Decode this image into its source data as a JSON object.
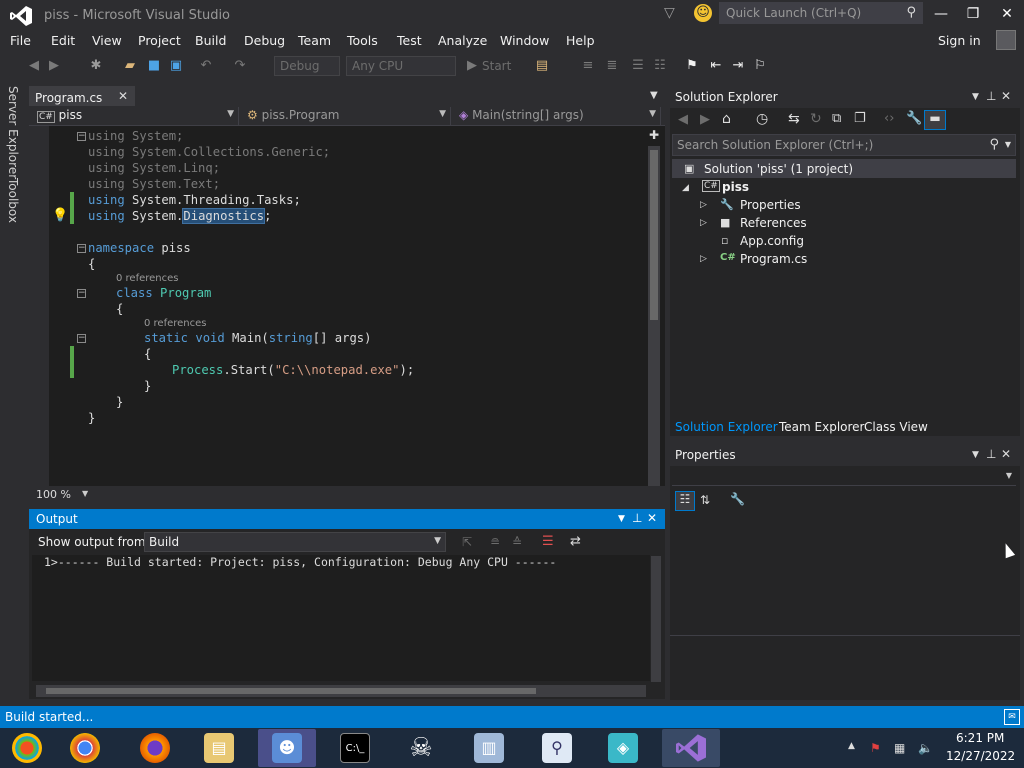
{
  "window": {
    "title": "piss - Microsoft Visual Studio",
    "quick_launch_placeholder": "Quick Launch (Ctrl+Q)"
  },
  "menu": {
    "items": [
      "File",
      "Edit",
      "View",
      "Project",
      "Build",
      "Debug",
      "Team",
      "Tools",
      "Test",
      "Analyze",
      "Window",
      "Help"
    ],
    "signin": "Sign in"
  },
  "toolbar": {
    "config": "Debug",
    "platform": "Any CPU",
    "start": "Start"
  },
  "left_tabs": [
    "Server Explorer",
    "Toolbox"
  ],
  "editor": {
    "tab": "Program.cs",
    "nav_project": "piss",
    "nav_class": "piss.Program",
    "nav_member": "Main(string[] args)",
    "zoom": "100 %",
    "ref_label": "0 references",
    "lines": {
      "u1_kw": "using",
      "u1_rest": " System;",
      "u2_kw": "using",
      "u2_rest": " System.Collections.Generic;",
      "u3_kw": "using",
      "u3_rest": " System.Linq;",
      "u4_kw": "using",
      "u4_rest": " System.Text;",
      "u5_kw": "using",
      "u5_rest": " System.Threading.Tasks;",
      "u6_kw": "using",
      "u6_a": " System.",
      "u6_b": "Diagnostics",
      "u6_c": ";",
      "ns_kw": "namespace",
      "ns_name": " piss",
      "brace_open": "{",
      "class_kw": "class",
      "class_name": " Program",
      "brace_open2": "{",
      "main_kw1": "static",
      "main_kw2": " void",
      "main_name": " Main(",
      "main_type": "string",
      "main_rest": "[] args)",
      "brace_open3": "{",
      "proc_type": "Process",
      "proc_mid": ".Start(",
      "proc_str": "\"C:\\\\notepad.exe\"",
      "proc_end": ");",
      "brace_close3": "}",
      "brace_close2": "}",
      "brace_close": "}"
    }
  },
  "output": {
    "title": "Output",
    "show_from_label": "Show output from:",
    "source": "Build",
    "line1": "1>------ Build started: Project: piss, Configuration: Debug Any CPU ------"
  },
  "solution_explorer": {
    "title": "Solution Explorer",
    "search_placeholder": "Search Solution Explorer (Ctrl+;)",
    "solution": "Solution 'piss' (1 project)",
    "project": "piss",
    "items": [
      "Properties",
      "References",
      "App.config",
      "Program.cs"
    ],
    "tabs": [
      "Solution Explorer",
      "Team Explorer",
      "Class View"
    ]
  },
  "properties": {
    "title": "Properties"
  },
  "status": {
    "text": "Build started..."
  },
  "taskbar": {
    "time": "6:21 PM",
    "date": "12/27/2022"
  },
  "colors": {
    "accent": "#007acc",
    "keyword": "#569cd6",
    "type": "#4ec9b0",
    "string": "#d69d85"
  }
}
